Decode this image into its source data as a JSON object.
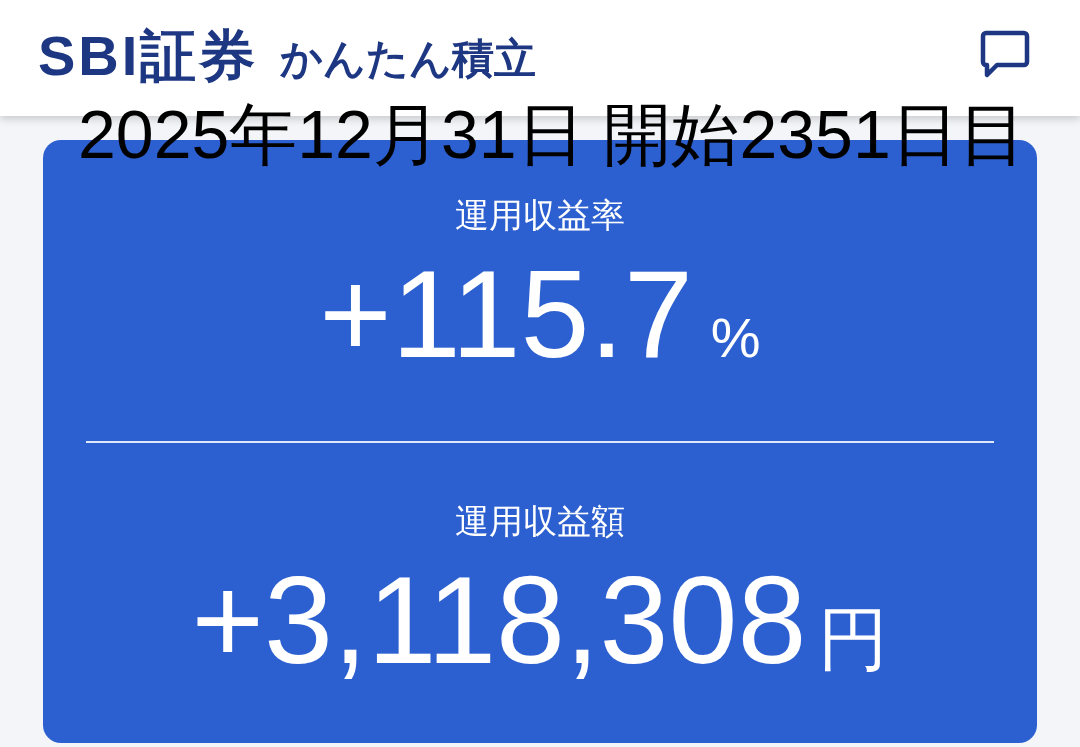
{
  "header": {
    "logo": "SBI証券",
    "app_name": "かんたん積立"
  },
  "caption": "2025年12月31日 開始2351日目",
  "summary": [
    {
      "label": "運用収益率",
      "value": "+115.7",
      "unit": "%"
    },
    {
      "label": "運用収益額",
      "value": "+3,118,308",
      "unit": "円"
    }
  ]
}
